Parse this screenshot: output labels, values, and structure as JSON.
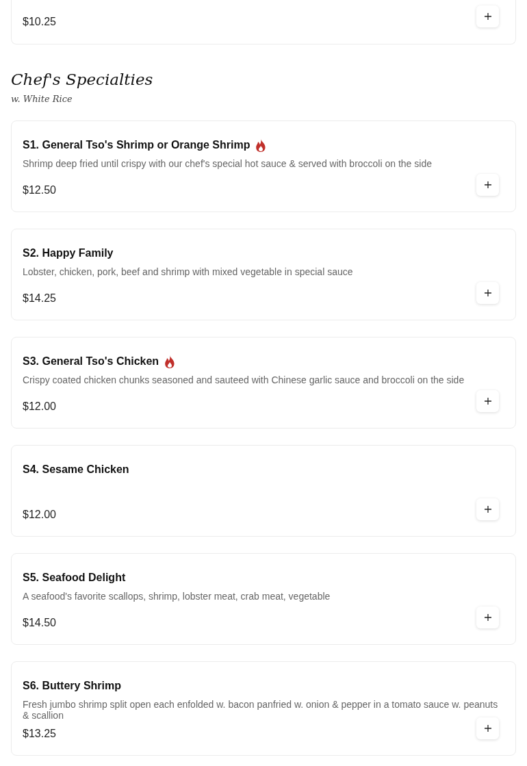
{
  "previous_item": {
    "price": "$10.25"
  },
  "section": {
    "title": "Chef's Specialties",
    "subtitle": "w. White Rice"
  },
  "items": [
    {
      "name": "S1. General Tso's Shrimp or Orange Shrimp",
      "spicy": true,
      "description": "Shrimp deep fried until crispy with our chef's special hot sauce & served with broccoli on the side",
      "price": "$12.50"
    },
    {
      "name": "S2. Happy Family",
      "spicy": false,
      "description": "Lobster, chicken, pork, beef and shrimp with mixed vegetable in special sauce",
      "price": "$14.25"
    },
    {
      "name": "S3. General Tso's Chicken",
      "spicy": true,
      "description": "Crispy coated chicken chunks seasoned and sauteed with Chinese garlic sauce and broccoli on the side",
      "price": "$12.00"
    },
    {
      "name": "S4. Sesame Chicken",
      "spicy": false,
      "price": "$12.00"
    },
    {
      "name": "S5. Seafood Delight",
      "spicy": false,
      "description": "A seafood's favorite scallops, shrimp, lobster meat, crab meat, vegetable",
      "price": "$14.50"
    },
    {
      "name": "S6. Buttery Shrimp",
      "spicy": false,
      "description": "Fresh jumbo shrimp split open each enfolded w. bacon panfried w. onion & pepper in a tomato sauce w. peanuts & scallion",
      "price": "$13.25"
    }
  ]
}
